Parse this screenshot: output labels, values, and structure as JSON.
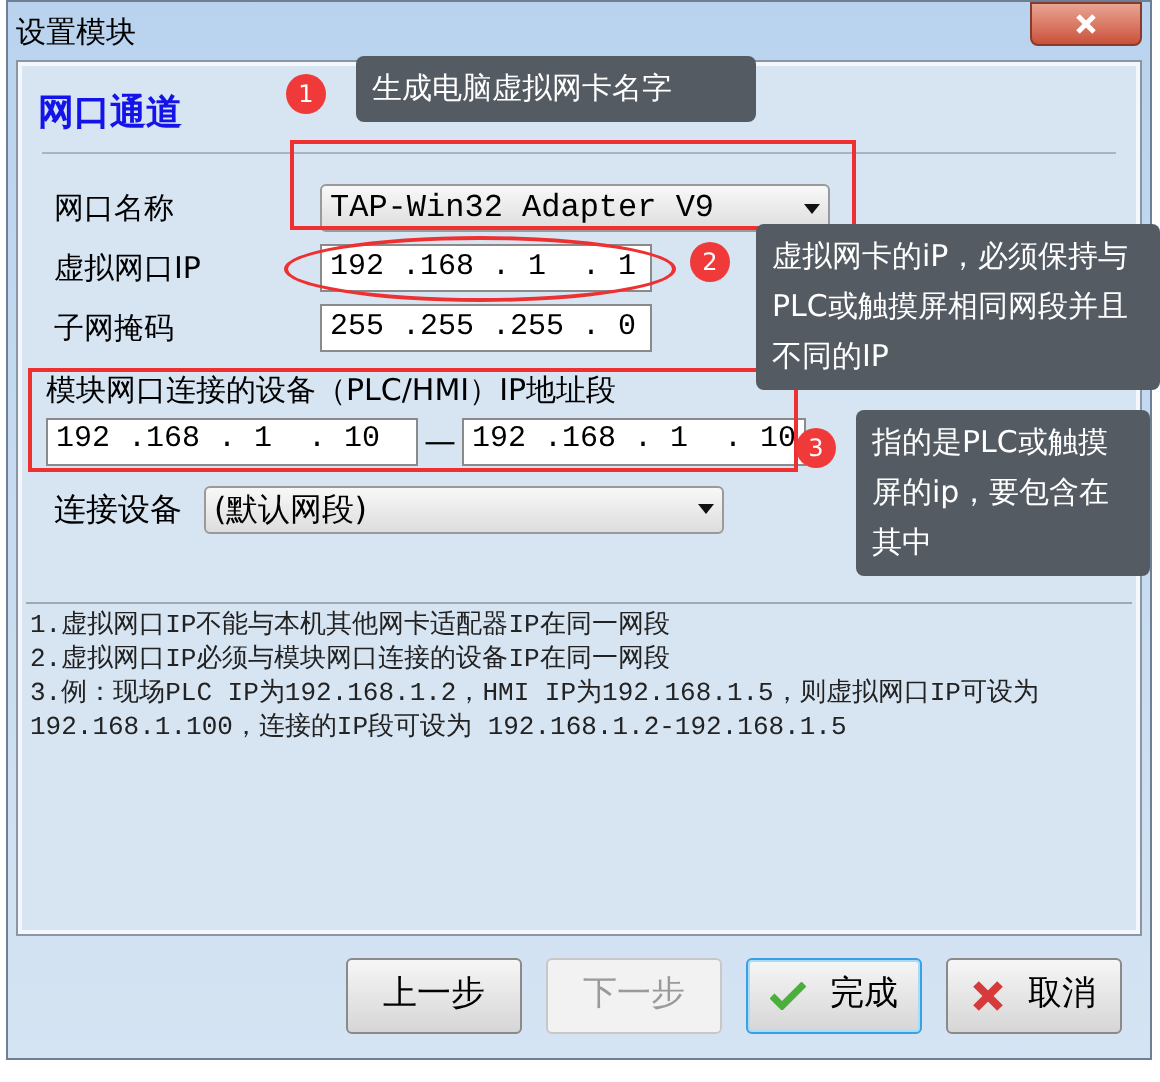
{
  "window": {
    "title": "设置模块"
  },
  "section_title": "网口通道",
  "fields": [
    {
      "kind": "select",
      "label": "网口名称",
      "value": "TAP-Win32 Adapter V9"
    },
    {
      "kind": "ip",
      "label": "虚拟网口IP",
      "value": "192 .168 . 1  . 1"
    },
    {
      "kind": "ip",
      "label": "子网掩码",
      "value": "255 .255 .255 . 0"
    }
  ],
  "range": {
    "label": "模块网口连接的设备（PLC/HMI）IP地址段",
    "start": "192 .168 . 1  . 10",
    "separator": "—",
    "end": "192 .168 . 1  . 10"
  },
  "device": {
    "label": "连接设备",
    "value": "(默认网段)"
  },
  "notes": [
    "1.虚拟网口IP不能与本机其他网卡适配器IP在同一网段",
    "2.虚拟网口IP必须与模块网口连接的设备IP在同一网段",
    "3.例：现场PLC IP为192.168.1.2，HMI IP为192.168.1.5，则虚拟网口IP可设为192.168.1.100，连接的IP段可设为 192.168.1.2-192.168.1.5"
  ],
  "buttons": [
    {
      "label": "上一步",
      "kind": "plain",
      "disabled": false,
      "default": false
    },
    {
      "label": "下一步",
      "kind": "plain",
      "disabled": true,
      "default": false
    },
    {
      "label": "完成",
      "kind": "confirm",
      "disabled": false,
      "default": true
    },
    {
      "label": "取消",
      "kind": "cancel",
      "disabled": false,
      "default": false
    }
  ],
  "callouts": [
    {
      "number": "1",
      "text": "生成电脑虚拟网卡名字"
    },
    {
      "number": "2",
      "text": "虚拟网卡的iP，必须保持与PLC或触摸屏相同网段并且不同的IP"
    },
    {
      "number": "3",
      "text": "指的是PLC或触摸屏的ip，要包含在其中"
    }
  ]
}
